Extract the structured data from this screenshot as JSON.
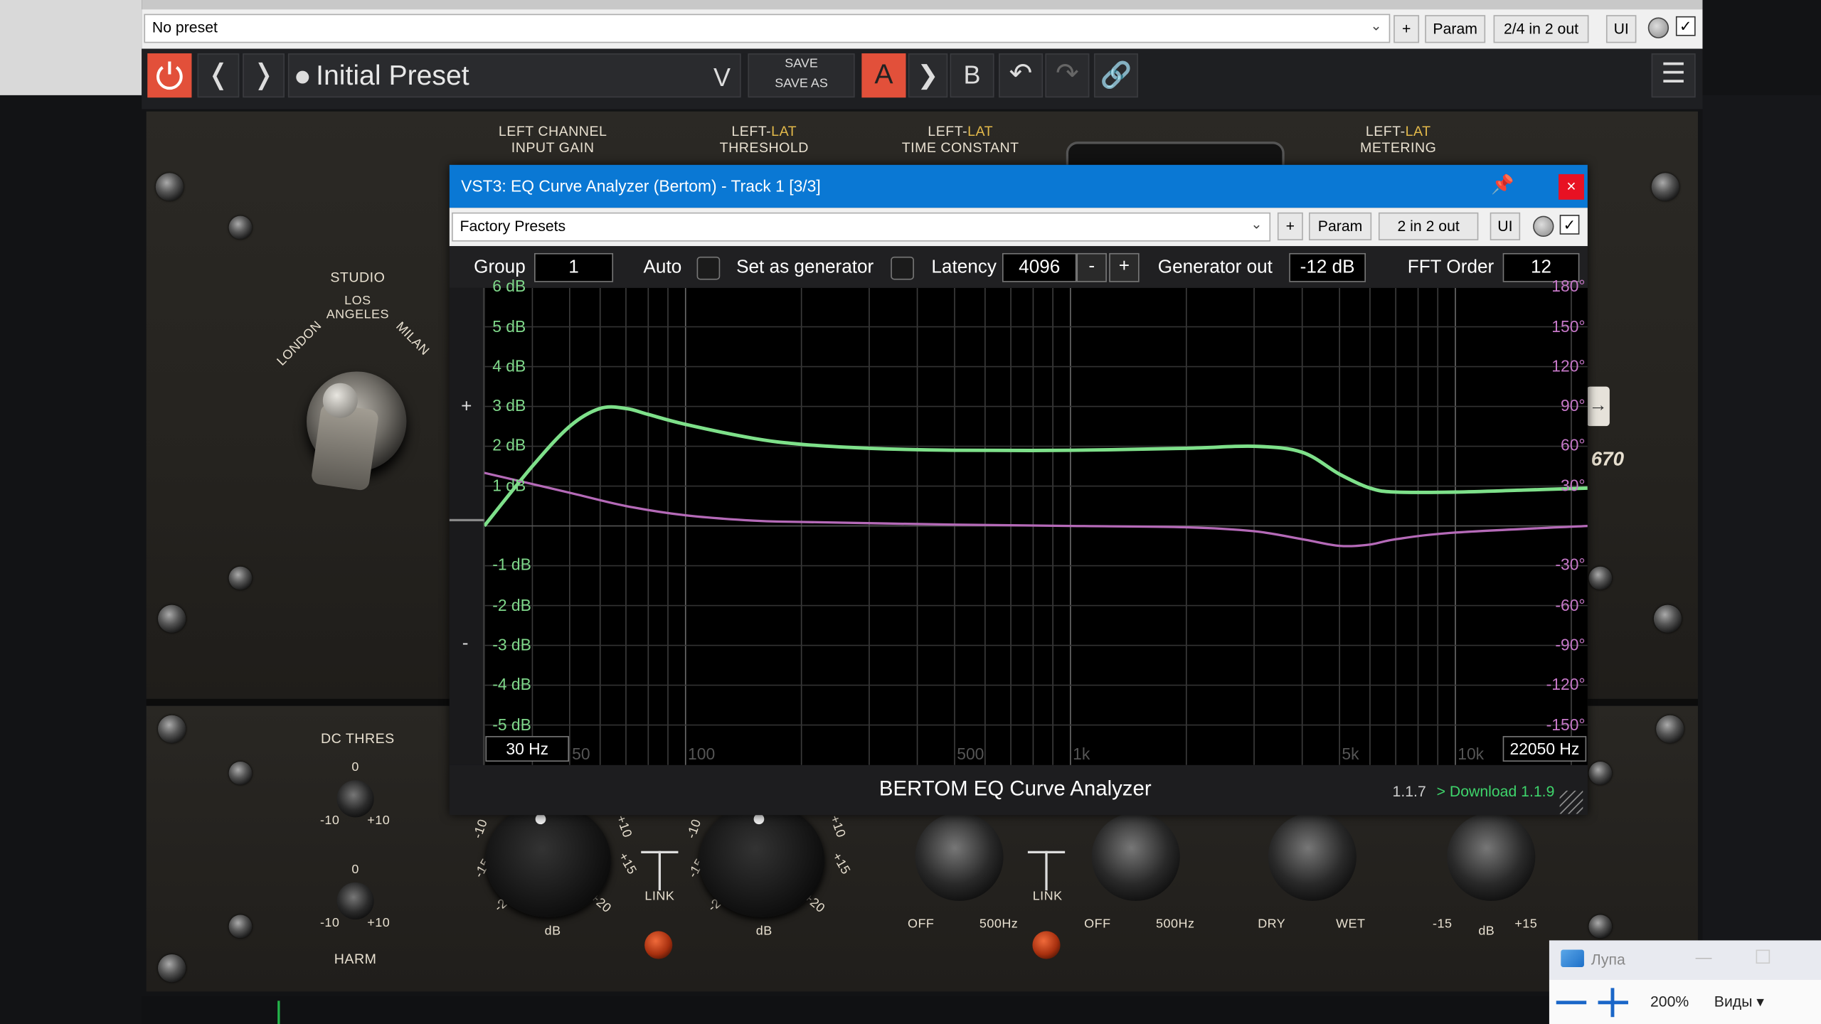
{
  "host": {
    "preset_combo": "No preset",
    "plus_btn": "+",
    "param_btn": "Param",
    "io_btn": "2/4 in 2 out",
    "ui_btn": "UI",
    "bypass_checked": "✓"
  },
  "plugin_toolbar": {
    "preset_name": "Initial Preset",
    "dropdown_glyph": "V",
    "save": "SAVE",
    "save_as": "SAVE AS",
    "a_label": "A",
    "arrow_label": "❯",
    "b_label": "B"
  },
  "hardware": {
    "left_input_gain_line1": "LEFT CHANNEL",
    "left_input_gain_line2": "INPUT GAIN",
    "threshold_prefix": "LEFT-",
    "threshold_lat": "LAT",
    "threshold": "THRESHOLD",
    "time_constant": "TIME CONSTANT",
    "metering": "METERING",
    "studio": "STUDIO",
    "los_angeles_line1": "LOS",
    "los_angeles_line2": "ANGELES",
    "london": "LONDON",
    "milan": "MILAN",
    "model_fragment": "670",
    "dc_thres": "DC THRES",
    "harm": "HARM",
    "zero": "0",
    "minus10": "-10",
    "plus10": "+10",
    "link": "LINK",
    "db": "dB",
    "off": "OFF",
    "hz500": "500Hz",
    "dry": "DRY",
    "wet": "WET",
    "minus15": "-15",
    "plus15": "+15",
    "knob_scale": {
      "m10": "-10",
      "m15": "-15",
      "m20": "-20",
      "p10": "+10",
      "p15": "+15",
      "p20": "+20"
    }
  },
  "analyzer_window": {
    "title": "VST3: EQ Curve Analyzer (Bertom) - Track 1 [3/3]",
    "close": "×",
    "preset_combo": "Factory Presets",
    "plus_btn": "+",
    "param_btn": "Param",
    "io_btn": "2 in 2 out",
    "ui_btn": "UI",
    "bypass_checked": "✓"
  },
  "analyzer": {
    "group_label": "Group",
    "group_value": "1",
    "auto_label": "Auto",
    "generator_label": "Set as generator",
    "latency_label": "Latency",
    "latency_value": "4096",
    "minus": "-",
    "plus": "+",
    "gen_out_label": "Generator out",
    "gen_out_value": "-12 dB",
    "fft_label": "FFT Order",
    "fft_value": "12",
    "zoom_plus": "+",
    "zoom_minus": "-",
    "freq_min": "30 Hz",
    "freq_max": "22050 Hz",
    "footer_title": "BERTOM EQ Curve Analyzer",
    "version": "1.1.7",
    "download": "> Download 1.1.9"
  },
  "chart_data": {
    "type": "line",
    "xscale": "log",
    "xlim": [
      30,
      22050
    ],
    "ylim_left": [
      -6,
      6
    ],
    "ylim_right": [
      -180,
      180
    ],
    "ylabel_left_ticks": [
      "6 dB",
      "5 dB",
      "4 dB",
      "3 dB",
      "2 dB",
      "1 dB",
      "-1 dB",
      "-2 dB",
      "-3 dB",
      "-4 dB",
      "-5 dB"
    ],
    "ylabel_right_ticks": [
      "180°",
      "150°",
      "120°",
      "90°",
      "60°",
      "30°",
      "-30°",
      "-60°",
      "-90°",
      "-120°",
      "-150°"
    ],
    "x_ticks": [
      "50",
      "100",
      "500",
      "1k",
      "5k",
      "10k"
    ],
    "x_tick_values": [
      50,
      100,
      500,
      1000,
      5000,
      10000
    ],
    "grid": true,
    "series": [
      {
        "color": "#7ee08a",
        "axis": "left",
        "x": [
          30,
          40,
          50,
          60,
          70,
          80,
          100,
          150,
          200,
          300,
          500,
          1000,
          2000,
          3000,
          4000,
          5000,
          6000,
          7000,
          10000,
          15000,
          22050
        ],
        "y": [
          0.0,
          1.5,
          2.5,
          2.95,
          2.95,
          2.8,
          2.55,
          2.2,
          2.05,
          1.95,
          1.9,
          1.9,
          1.95,
          2.0,
          1.85,
          1.3,
          0.95,
          0.85,
          0.85,
          0.9,
          0.95
        ]
      },
      {
        "color": "#b56ab8",
        "axis": "right",
        "x": [
          30,
          50,
          70,
          100,
          150,
          200,
          500,
          1000,
          2000,
          3000,
          4000,
          5000,
          6000,
          7000,
          10000,
          22050
        ],
        "y": [
          40,
          25,
          15,
          8,
          4,
          3,
          1,
          0,
          -1,
          -4,
          -10,
          -15,
          -14,
          -10,
          -5,
          0
        ]
      }
    ]
  },
  "magnifier": {
    "title": "Лупа",
    "zoom": "200%",
    "views": "Виды"
  }
}
